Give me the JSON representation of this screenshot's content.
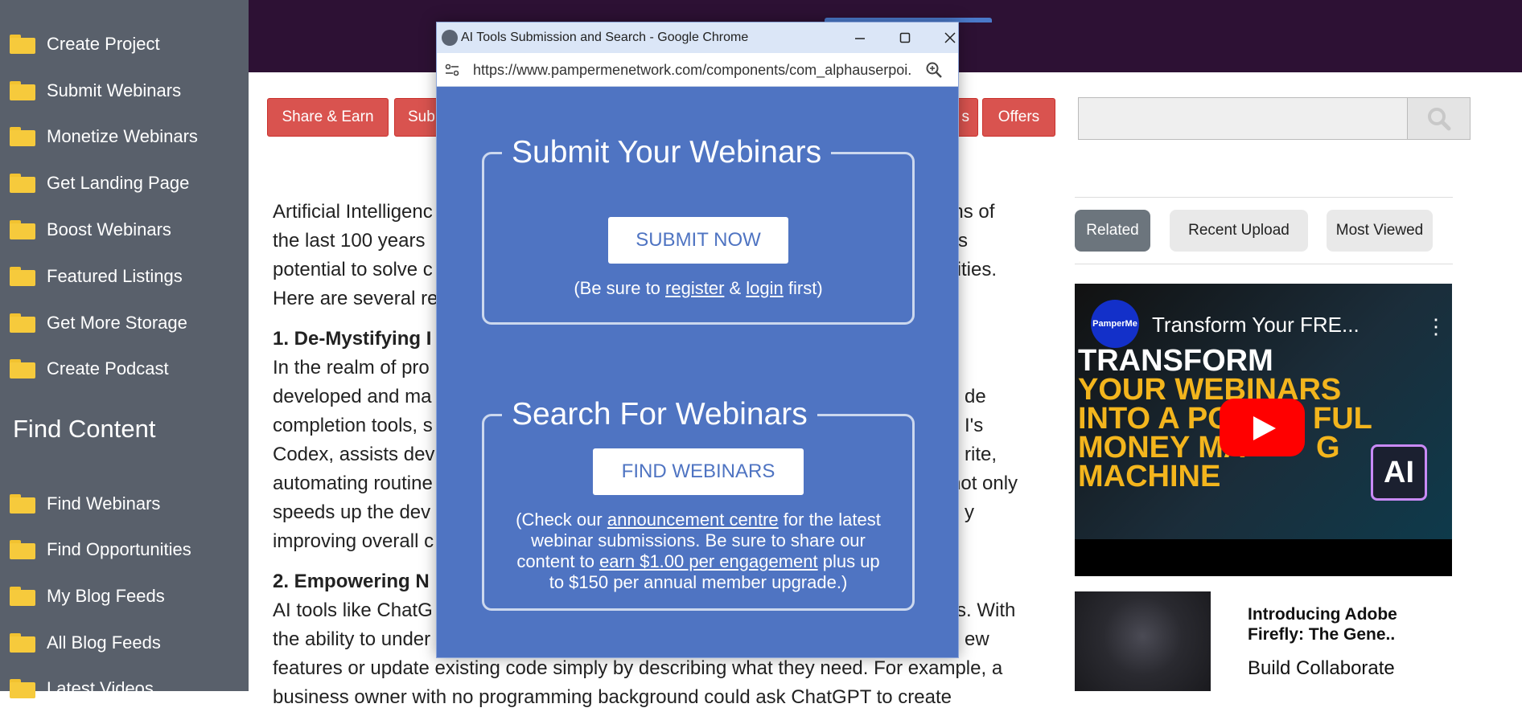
{
  "sidebar": {
    "items_top": [
      {
        "label": "Create Project"
      },
      {
        "label": "Submit Webinars"
      },
      {
        "label": "Monetize Webinars"
      },
      {
        "label": "Get Landing Page"
      },
      {
        "label": "Boost Webinars"
      },
      {
        "label": "Featured Listings"
      },
      {
        "label": "Get More Storage"
      },
      {
        "label": "Create Podcast"
      }
    ],
    "section_title": "Find Content",
    "items_bottom": [
      {
        "label": "Find Webinars"
      },
      {
        "label": "Find Opportunities"
      },
      {
        "label": "My Blog Feeds"
      },
      {
        "label": "All Blog Feeds"
      },
      {
        "label": "Latest Videos"
      }
    ],
    "folder_color": "#f6ca3c"
  },
  "nav_buttons": {
    "share_earn": "Share & Earn",
    "submit_partial": "Sub",
    "hidden_partial": "s",
    "offers": "Offers",
    "color": "#d9534f"
  },
  "search": {
    "value": "",
    "icon": "search-icon"
  },
  "article": {
    "lines": [
      "Artificial Intelligenc",
      "the last 100 years",
      "potential to solve c",
      "Here are several re",
      "1. De-Mystifying I",
      "In the realm of pro",
      "developed and ma",
      "completion tools, s",
      "Codex, assists dev",
      "automating routine",
      "speeds up the dev",
      "improving overall c",
      "2. Empowering N",
      "AI tools like ChatG",
      "the ability to under",
      "features or update existing code simply by describing what they need. For example, a",
      "business owner with no programming background could ask ChatGPT to create"
    ],
    "right_fragments": [
      "tions of",
      "its",
      "ilities.",
      "de",
      "I's",
      "rite,",
      "not only",
      "y",
      "rs. With",
      "ew"
    ]
  },
  "related_tabs": {
    "related": "Related",
    "recent_upload": "Recent Upload",
    "most_viewed": "Most Viewed",
    "active": "Related"
  },
  "video": {
    "channel_logo": "PamperMe",
    "title": "Transform Your FRE...",
    "overlay_lines": [
      "TRANSFORM",
      "YOUR WEBINARS",
      "INTO A PO",
      "MONEY MA",
      "MACHINE"
    ],
    "overlay_suffixes": [
      "",
      "",
      "FUL",
      "G",
      ""
    ],
    "badge": "AI"
  },
  "card": {
    "title": "Introducing Adobe Firefly: The Gene..",
    "subtitle": "Build Collaborate"
  },
  "popup": {
    "window_title": "AI Tools Submission and Search - Google Chrome",
    "url": "https://www.pampermenetwork.com/components/com_alphauserpoi...",
    "submit_section": {
      "legend": "Submit Your Webinars",
      "button": "SUBMIT NOW",
      "note_prefix": "(Be sure to ",
      "note_register": "register",
      "note_amp": " & ",
      "note_login": "login",
      "note_suffix": " first)"
    },
    "search_section": {
      "legend": "Search For Webinars",
      "button": "FIND WEBINARS",
      "line1_prefix": "(Check our ",
      "line1_link": "announcement centre",
      "line1_suffix": " for the latest",
      "line2": "webinar submissions. Be sure to share our",
      "line3_prefix": "content to ",
      "line3_link": "earn $1.00 per engagement",
      "line3_suffix": " plus up",
      "line4": "to $150 per annual member upgrade.)"
    },
    "bg_color": "#4f74c2"
  }
}
